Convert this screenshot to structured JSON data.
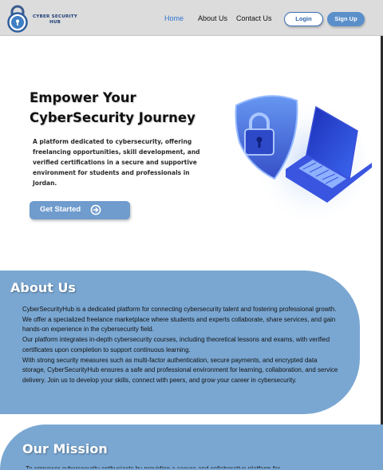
{
  "navbar": {
    "brand_line1": "CYBER SECURITY",
    "brand_line2": "HUB",
    "links": [
      "Home",
      "About Us",
      "Contact Us"
    ],
    "active_link": "Home",
    "login_label": "Login",
    "signup_label": "Sign Up"
  },
  "hero": {
    "title_line1": "Empower Your",
    "title_line2": "CyberSecurity Journey",
    "description": "A platform dedicated to cybersecurity, offering freelancing opportunities, skill development, and verified certifications in a secure and supportive environment for students and professionals in Jordan.",
    "cta_label": "Get Started",
    "cta_icon": "arrow-circle-right-icon",
    "illustration": "shield-padlock-laptop"
  },
  "about": {
    "title": "About Us",
    "paragraph1": "CyberSecurityHub is a dedicated platform for connecting cybersecurity talent and fostering professional growth. We offer a specialized freelance marketplace where students and experts collaborate, share services, and gain hands-on experience in the cybersecurity field.",
    "paragraph2": "Our platform integrates in-depth cybersecurity courses, including theoretical lessons and exams, with verified certificates upon completion to support continuous learning.",
    "paragraph3": "With strong security measures such as multi-factor authentication, secure payments, and encrypted data storage, CyberSecurityHub ensures a safe and professional environment for learning, collaboration, and service delivery. Join us to develop your skills, connect with peers, and grow your career in cybersecurity."
  },
  "mission": {
    "title": "Our Mission",
    "text": "To empower cybersecurity enthusiasts by providing a secure and collaborative platform for"
  },
  "colors": {
    "navbar_bg": "#dcdcdc",
    "accent": "#2f74d0",
    "button_blue": "#5b8fca",
    "section_blue": "#7aa7d2"
  }
}
